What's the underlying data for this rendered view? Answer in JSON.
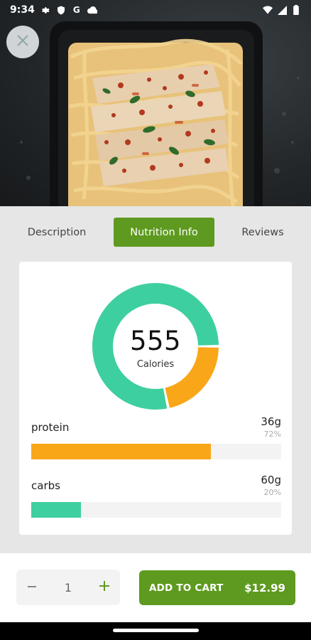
{
  "status_bar": {
    "time": "9:34",
    "left_icons": [
      "gear-icon",
      "shield-icon",
      "google-g-icon",
      "cloud-icon"
    ],
    "right_icons": [
      "wifi-icon",
      "signal-icon",
      "battery-icon"
    ],
    "google_letter": "G"
  },
  "hero": {
    "image": "photo of grilled chicken slices with chili flakes and herbs on noodles in a black container"
  },
  "close_button": {
    "icon": "close-icon"
  },
  "tabs": [
    {
      "label": "Description",
      "active": false
    },
    {
      "label": "Nutrition Info",
      "active": true
    },
    {
      "label": "Reviews",
      "active": false
    }
  ],
  "nutrition": {
    "calories_value": "555",
    "calories_label": "Calories",
    "donut": {
      "segments": [
        {
          "name": "protein",
          "fraction": 0.72,
          "color": "#3ecfa0"
        },
        {
          "name": "carbs",
          "fraction": 0.2,
          "color": "#faa619"
        }
      ]
    },
    "macros": [
      {
        "name": "protein",
        "amount": "36g",
        "percent": "72%",
        "fraction": 0.72,
        "color": "#faa619"
      },
      {
        "name": "carbs",
        "amount": "60g",
        "percent": "20%",
        "fraction": 0.2,
        "color": "#3ecfa0"
      }
    ]
  },
  "cart": {
    "quantity": "1",
    "decrement_icon": "minus-icon",
    "increment_icon": "plus-icon",
    "add_label": "ADD TO CART",
    "price": "$12.99"
  },
  "colors": {
    "accent": "#5e9a1f",
    "teal": "#3ecfa0",
    "orange": "#faa619",
    "background": "#e6e6e6"
  }
}
